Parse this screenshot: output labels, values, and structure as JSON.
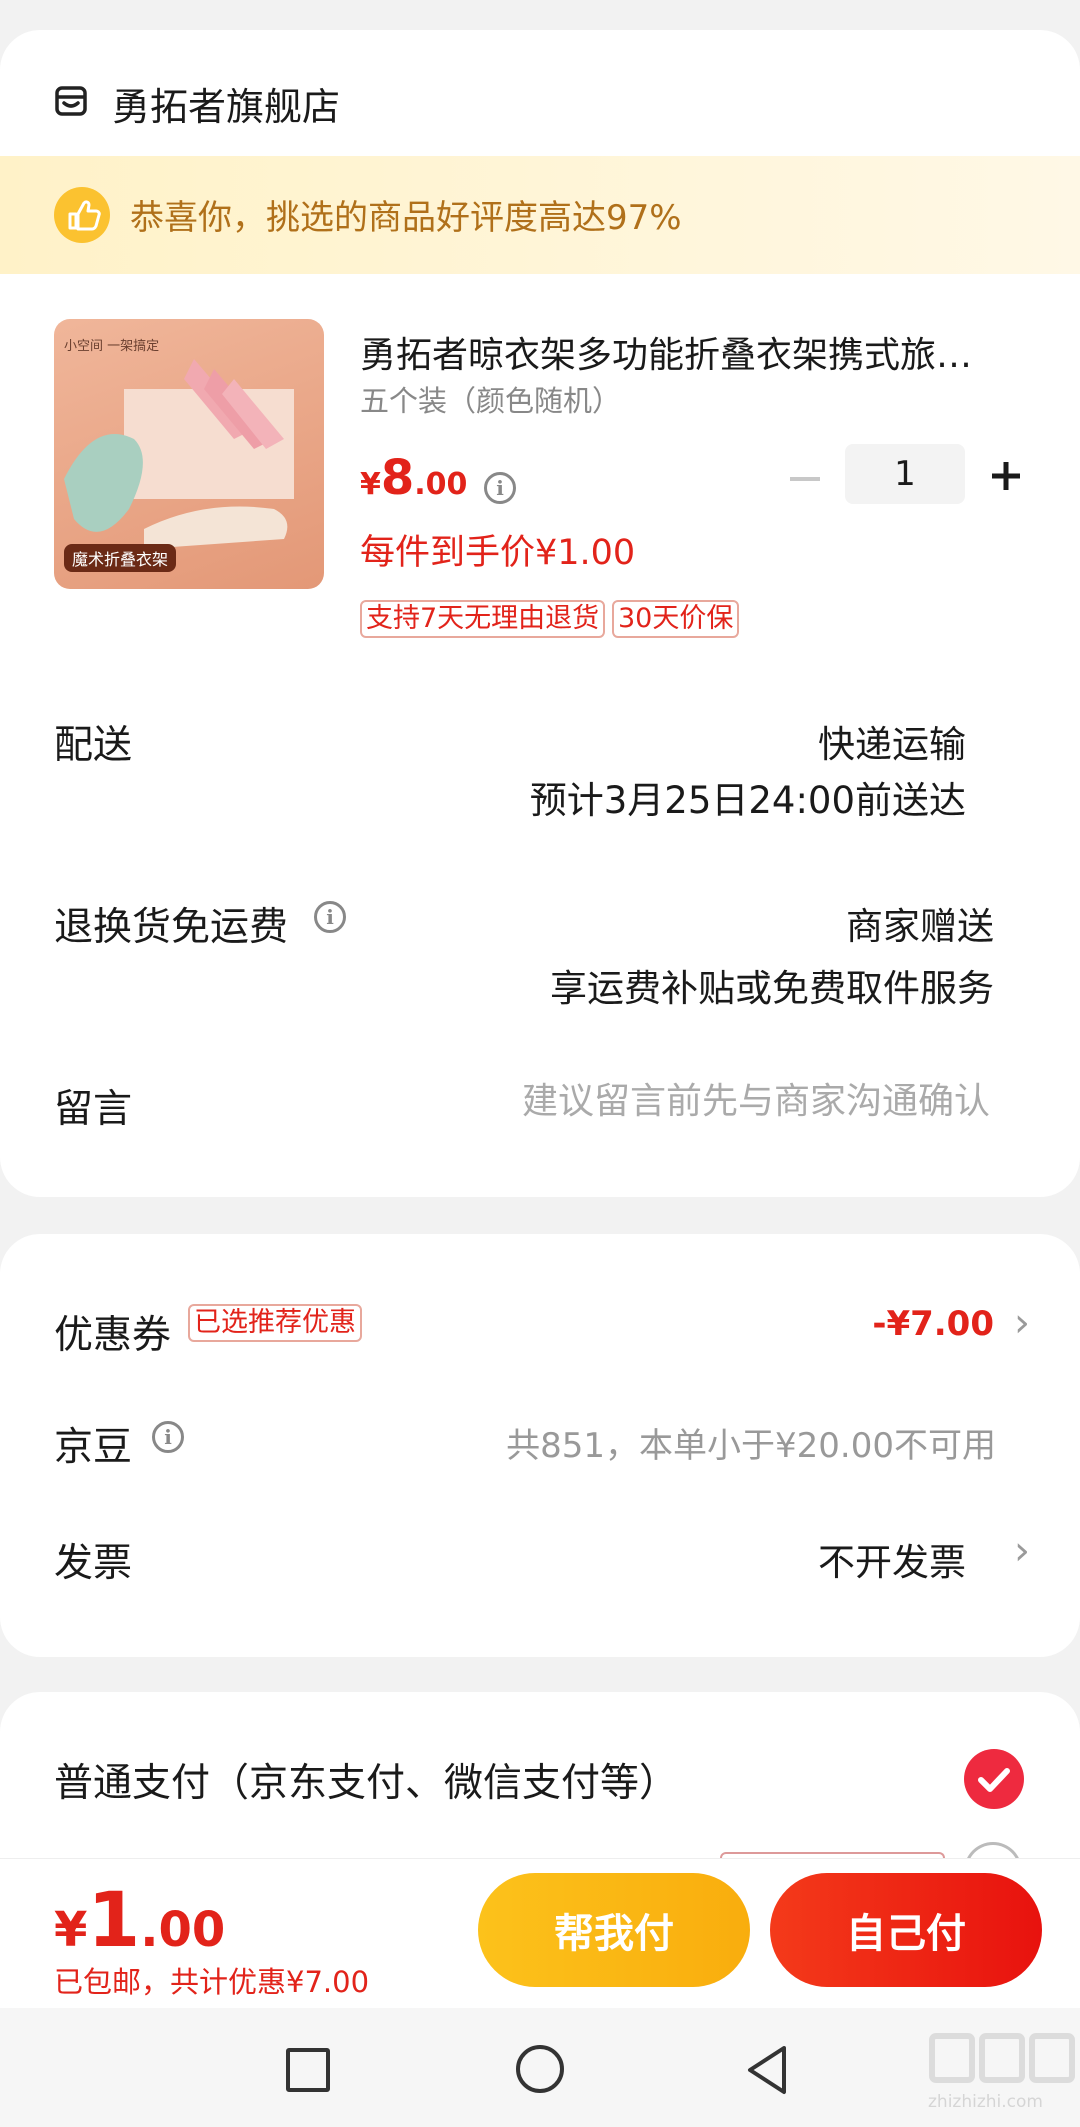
{
  "store": {
    "name": "勇拓者旗舰店",
    "icon": "store-icon"
  },
  "banner": {
    "text": "恭喜你，挑选的商品好评度高达97%",
    "icon": "thumbs-up-icon",
    "bg_color": "#fff6dc",
    "text_color": "#b0701a"
  },
  "product": {
    "title": "勇拓者晾衣架多功能折叠衣架携式旅…",
    "variant": "五个装（颜色随机）",
    "image_text_top": "小空间 一架搞定",
    "image_label": "魔术折叠衣架",
    "price_symbol": "¥",
    "price_int": "8",
    "price_dec": ".00",
    "unit_price": "每件到手价¥1.00",
    "quantity": "1",
    "tags": [
      "支持7天无理由退货",
      "30天价保"
    ]
  },
  "delivery": {
    "label": "配送",
    "method": "快递运输",
    "eta": "预计3月25日24:00前送达"
  },
  "return_shipping": {
    "label": "退换货免运费",
    "value": "商家赠送",
    "desc": "享运费补贴或免费取件服务"
  },
  "message": {
    "label": "留言",
    "placeholder": "建议留言前先与商家沟通确认"
  },
  "coupon": {
    "label": "优惠券",
    "badge": "已选推荐优惠",
    "value": "-¥7.00"
  },
  "jingdou": {
    "label": "京豆",
    "value": "共851，本单小于¥20.00不可用"
  },
  "invoice": {
    "label": "发票",
    "value": "不开发票"
  },
  "payment": {
    "label": "普通支付（京东支付、微信支付等）",
    "selected": true
  },
  "footer": {
    "total_symbol": "¥",
    "total_int": "1",
    "total_dec": ".00",
    "summary": "已包邮，共计优惠¥7.00",
    "help_pay": "帮我付",
    "self_pay": "自己付"
  },
  "colors": {
    "accent": "#e2231a",
    "yellow_btn": "#fbb715",
    "red_btn": "#f02e14"
  },
  "watermark": "zhizhizhi.com"
}
